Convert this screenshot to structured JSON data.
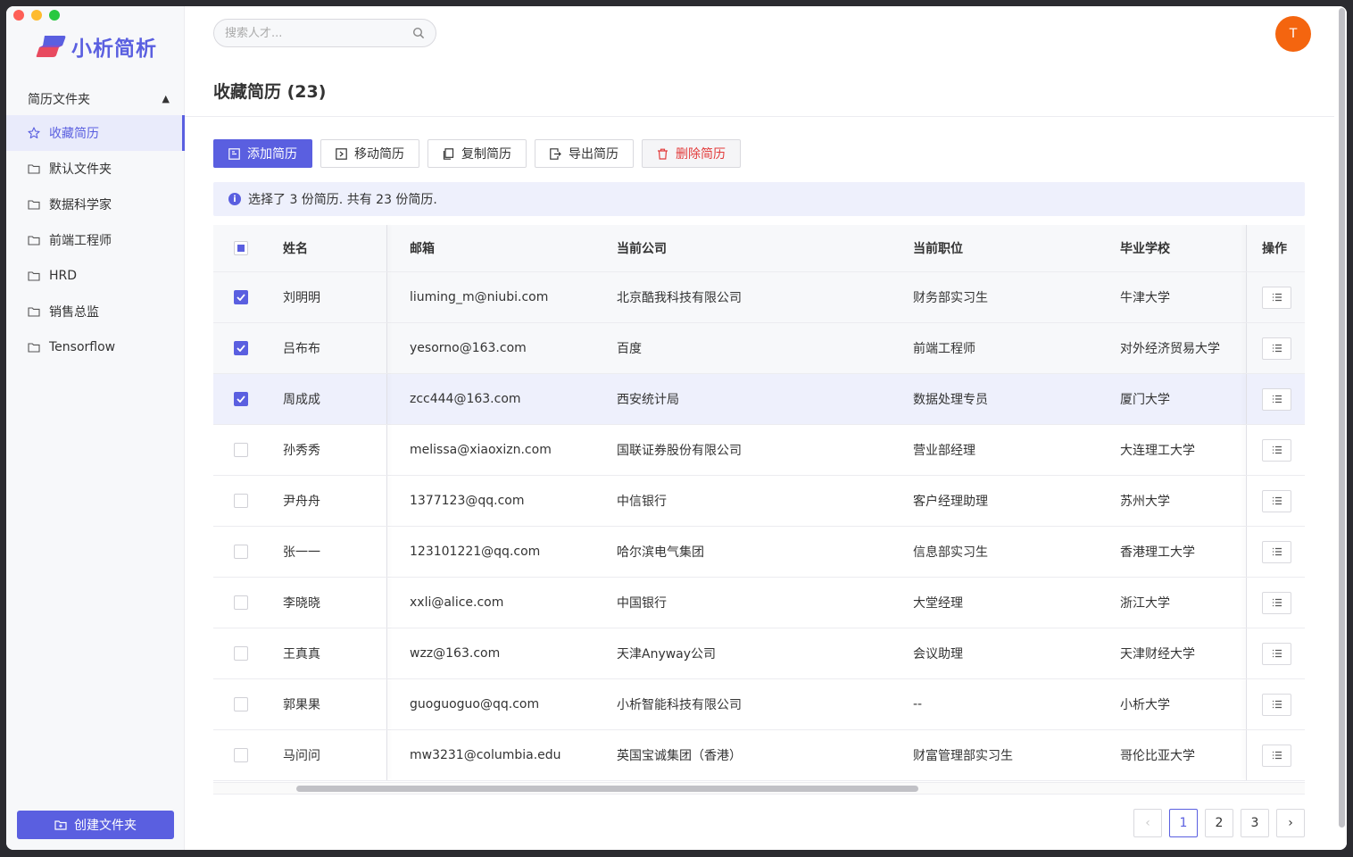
{
  "app": {
    "name": "小析简析"
  },
  "sidebar": {
    "section_title": "简历文件夹",
    "items": [
      {
        "label": "收藏简历",
        "icon": "star-icon",
        "active": true
      },
      {
        "label": "默认文件夹",
        "icon": "folder-icon"
      },
      {
        "label": "数据科学家",
        "icon": "folder-icon"
      },
      {
        "label": "前端工程师",
        "icon": "folder-icon"
      },
      {
        "label": "HRD",
        "icon": "folder-icon"
      },
      {
        "label": "销售总监",
        "icon": "folder-icon"
      },
      {
        "label": "Tensorflow",
        "icon": "folder-icon"
      }
    ],
    "create_label": "创建文件夹"
  },
  "header": {
    "search_placeholder": "搜索人才...",
    "avatar_initial": "T"
  },
  "page": {
    "title": "收藏简历 (23)"
  },
  "toolbar": {
    "add": "添加简历",
    "move": "移动简历",
    "copy": "复制简历",
    "export": "导出简历",
    "delete": "删除简历"
  },
  "alert": {
    "text": "选择了 3 份简历. 共有 23 份简历."
  },
  "table": {
    "columns": [
      "姓名",
      "邮箱",
      "当前公司",
      "当前职位",
      "毕业学校",
      "操作"
    ],
    "rows": [
      [
        "刘明明",
        "liuming_m@niubi.com",
        "北京酷我科技有限公司",
        "财务部实习生",
        "牛津大学"
      ],
      [
        "吕布布",
        "yesorno@163.com",
        "百度",
        "前端工程师",
        "对外经济贸易大学"
      ],
      [
        "周成成",
        "zcc444@163.com",
        "西安统计局",
        "数据处理专员",
        "厦门大学"
      ],
      [
        "孙秀秀",
        "melissa@xiaoxizn.com",
        "国联证券股份有限公司",
        "营业部经理",
        "大连理工大学"
      ],
      [
        "尹舟舟",
        "1377123@qq.com",
        "中信银行",
        "客户经理助理",
        "苏州大学"
      ],
      [
        "张一一",
        "123101221@qq.com",
        "哈尔滨电气集团",
        "信息部实习生",
        "香港理工大学"
      ],
      [
        "李晓晓",
        "xxli@alice.com",
        "中国银行",
        "大堂经理",
        "浙江大学"
      ],
      [
        "王真真",
        "wzz@163.com",
        "天津Anyway公司",
        "会议助理",
        "天津财经大学"
      ],
      [
        "郭果果",
        "guoguoguo@qq.com",
        "小析智能科技有限公司",
        "--",
        "小析大学"
      ],
      [
        "马问问",
        "mw3231@columbia.edu",
        "英国宝诚集团（香港）",
        "财富管理部实习生",
        "哥伦比亚大学"
      ]
    ],
    "checked": [
      true,
      true,
      true,
      false,
      false,
      false,
      false,
      false,
      false,
      false
    ]
  },
  "pagination": {
    "pages": [
      "1",
      "2",
      "3"
    ],
    "current": "1",
    "prev": "‹",
    "next": "›"
  },
  "colors": {
    "accent": "#5a5fe0",
    "danger": "#e23b3b",
    "avatar": "#f4650f"
  }
}
